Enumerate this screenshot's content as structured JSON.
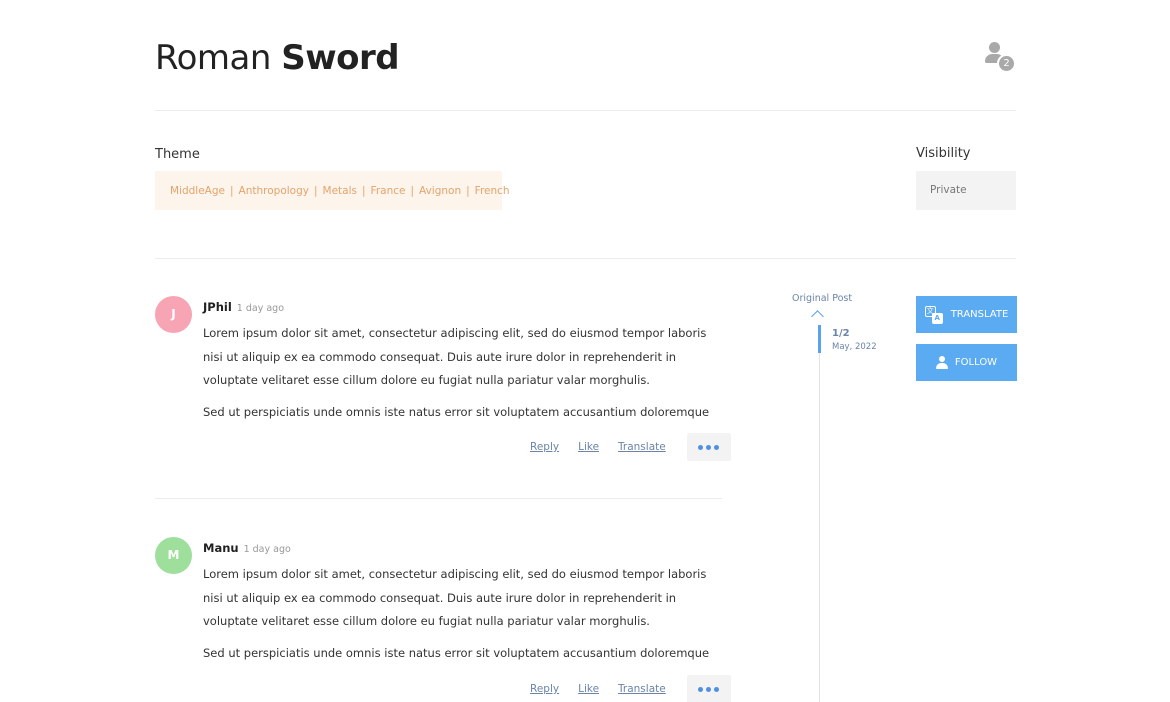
{
  "header": {
    "title_regular": "Roman",
    "title_bold": "Sword",
    "participants_count": "2"
  },
  "theme": {
    "label": "Theme",
    "tags": [
      "MiddleAge",
      "Anthropology",
      "Metals",
      "France",
      "Avignon",
      "French"
    ],
    "separator": "|"
  },
  "visibility": {
    "label": "Visibility",
    "value": "Private"
  },
  "comments": [
    {
      "initial": "J",
      "avatar_color": "#f7a5b5",
      "author": "JPhil",
      "time": "1 day ago",
      "line1": "Lorem ipsum dolor sit amet, consectetur adipiscing elit, sed do eiusmod tempor laboris nisi ut aliquip ex ea commodo consequat. Duis aute irure dolor in reprehenderit in voluptate velitaret esse cillum dolore eu fugiat nulla pariatur valar morghulis.",
      "line2": "Sed ut perspiciatis unde omnis iste natus error sit voluptatem accusantium doloremque",
      "actions": {
        "reply": "Reply",
        "like": "Like",
        "translate": "Translate"
      }
    },
    {
      "initial": "M",
      "avatar_color": "#9ddf9b",
      "author": "Manu",
      "time": "1 day ago",
      "line1": "Lorem ipsum dolor sit amet, consectetur adipiscing elit, sed do eiusmod tempor laboris nisi ut aliquip ex ea commodo consequat. Duis aute irure dolor in reprehenderit in voluptate velitaret esse cillum dolore eu fugiat nulla pariatur valar morghulis.",
      "line2": "Sed ut perspiciatis unde omnis iste natus error sit voluptatem accusantium doloremque",
      "actions": {
        "reply": "Reply",
        "like": "Like",
        "translate": "Translate"
      }
    }
  ],
  "timeline": {
    "original_post": "Original Post",
    "position": "1/2",
    "date": "May, 2022"
  },
  "buttons": {
    "translate": "TRANSLATE",
    "follow": "FOLLOW"
  },
  "colors": {
    "accent": "#5aabf2",
    "tag": "#e3a46c",
    "link": "#6b84a8"
  }
}
